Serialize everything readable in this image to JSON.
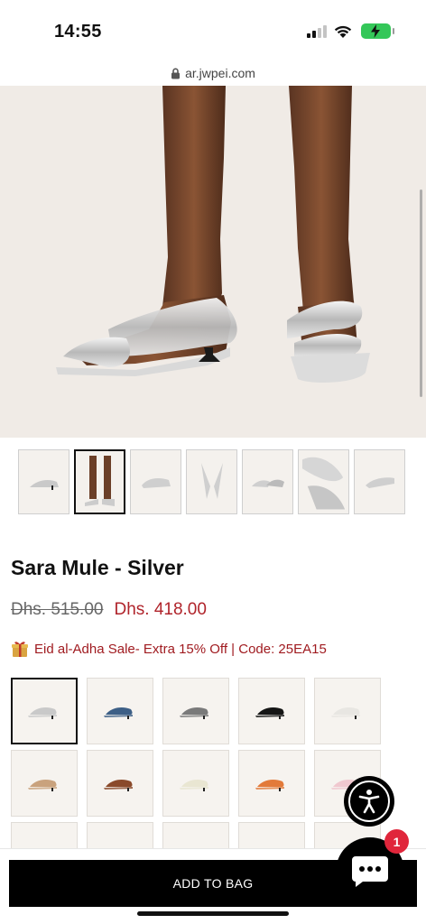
{
  "status": {
    "time": "14:55"
  },
  "browser": {
    "url": "ar.jwpei.com"
  },
  "product": {
    "title": "Sara Mule - Silver",
    "old_price": "Dhs. 515.00",
    "sale_price": "Dhs. 418.00",
    "promo": "Eid al-Adha Sale- Extra 15% Off | Code: 25EA15"
  },
  "thumbnails": [
    "silver-side",
    "model-legs",
    "silver-front",
    "silver-top",
    "silver-pair",
    "silver-detail",
    "silver-angle"
  ],
  "swatches": [
    {
      "name": "silver",
      "color": "#c9c9c9"
    },
    {
      "name": "blue",
      "color": "#3d5f86"
    },
    {
      "name": "grey",
      "color": "#7a7a7a"
    },
    {
      "name": "black",
      "color": "#151515"
    },
    {
      "name": "white",
      "color": "#e8e6e2"
    },
    {
      "name": "tan",
      "color": "#c9a27d"
    },
    {
      "name": "brown",
      "color": "#8a4a2b"
    },
    {
      "name": "cream",
      "color": "#e9e6d2"
    },
    {
      "name": "orange",
      "color": "#e27a3a"
    },
    {
      "name": "pink",
      "color": "#f0c8cf"
    }
  ],
  "actions": {
    "add_to_bag": "ADD TO BAG"
  },
  "chat": {
    "badge_count": "1"
  },
  "colors": {
    "sale": "#b0242b",
    "promo": "#a01b20",
    "badge": "#e0263b"
  }
}
